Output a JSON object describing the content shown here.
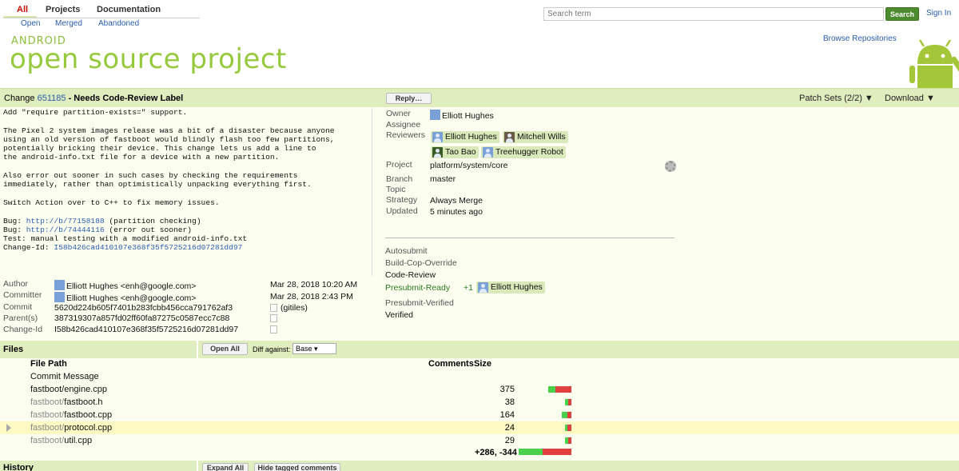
{
  "nav": {
    "tabs": [
      "All",
      "Projects",
      "Documentation"
    ],
    "subtabs": [
      "Open",
      "Merged",
      "Abandoned"
    ],
    "search_placeholder": "Search term",
    "search_label": "Search",
    "signin_label": "Sign In"
  },
  "banner": {
    "logo_small": "ANDROID",
    "logo_big": "open source project",
    "browse_label": "Browse Repositories"
  },
  "change": {
    "prefix": "Change",
    "number": "651185",
    "status": "- Needs Code-Review Label",
    "reply_label": "Reply…",
    "patch_sets": "Patch Sets (2/2) ▼",
    "download": "Download ▼"
  },
  "commit_message": "Add \"require partition-exists=\" support.\n\nThe Pixel 2 system images release was a bit of a disaster because anyone\nusing an old version of fastboot would blindly flash too few partitions,\npotentially bricking their device. This change lets us add a line to\nthe android-info.txt file for a device with a new partition.\n\nAlso error out sooner in such cases by checking the requirements\nimmediately, rather than optimistically unpacking everything first.\n\nSwitch Action over to C++ to fix memory issues.\n\nBug: ",
  "bugs": [
    {
      "prefix": "Bug: ",
      "link": "http://b/77158188",
      "note": " (partition checking)"
    },
    {
      "prefix": "Bug: ",
      "link": "http://b/74444116",
      "note": " (error out sooner)"
    }
  ],
  "test_line": "Test: manual testing with a modified android-info.txt",
  "change_id_label": "Change-Id: ",
  "change_id": "I58b426cad410107e368f35f5725216d07281dd97",
  "info": {
    "owner_label": "Owner",
    "owner": "Elliott Hughes",
    "assignee_label": "Assignee",
    "reviewers_label": "Reviewers",
    "reviewers": [
      "Elliott Hughes",
      "Mitchell Wills",
      "Tao Bao",
      "Treehugger Robot"
    ],
    "project_label": "Project",
    "project": "platform/system/core",
    "branch_label": "Branch",
    "branch": "master",
    "topic_label": "Topic",
    "strategy_label": "Strategy",
    "strategy": "Always Merge",
    "updated_label": "Updated",
    "updated": "5 minutes ago"
  },
  "labels": {
    "autosubmit": "Autosubmit",
    "build_cop": "Build-Cop-Override",
    "code_review": "Code-Review",
    "presubmit_ready": "Presubmit-Ready",
    "presubmit_vote": "+1",
    "presubmit_voter": "Elliott Hughes",
    "presubmit_verified": "Presubmit-Verified",
    "verified": "Verified"
  },
  "commit_info": {
    "author_label": "Author",
    "author": "Elliott Hughes <enh@google.com>",
    "author_date": "Mar 28, 2018 10:20 AM",
    "committer_label": "Committer",
    "committer": "Elliott Hughes <enh@google.com>",
    "committer_date": "Mar 28, 2018 2:43 PM",
    "commit_label": "Commit",
    "commit": "5620d224b605f7401b283fcbb456cca791762af3",
    "gitiles": "(gitiles)",
    "parent_label": "Parent(s)",
    "parent": "387319307a857fd02ff60fa87275c0587ecc7c88",
    "changeid_label": "Change-Id",
    "changeid": "I58b426cad410107e368f35f5725216d07281dd97"
  },
  "files": {
    "title": "Files",
    "open_all": "Open All",
    "diff_against_label": "Diff against:",
    "diff_against_value": "Base ▾",
    "col_path": "File Path",
    "col_comments": "Comments",
    "col_size": "Size",
    "commit_message_row": "Commit Message",
    "rows": [
      {
        "dir": "",
        "name": "fastboot/engine.cpp",
        "size": "375",
        "green": 0.3,
        "red": 0.7,
        "width": 0.75
      },
      {
        "dir": "fastboot/",
        "name": "fastboot.h",
        "size": "38",
        "green": 0.5,
        "red": 0.5,
        "width": 0.16
      },
      {
        "dir": "fastboot/",
        "name": "fastboot.cpp",
        "size": "164",
        "green": 0.55,
        "red": 0.45,
        "width": 0.32
      },
      {
        "dir": "fastboot/",
        "name": "protocol.cpp",
        "size": "24",
        "green": 0.4,
        "red": 0.6,
        "width": 0.12
      },
      {
        "dir": "fastboot/",
        "name": "util.cpp",
        "size": "29",
        "green": 0.5,
        "red": 0.5,
        "width": 0.12
      }
    ],
    "total": "+286, -344"
  },
  "history": {
    "title": "History",
    "expand_all": "Expand All",
    "hide_tagged": "Hide tagged comments"
  },
  "colors": {
    "accent_bar": "#e0edbe",
    "link": "#2a5db0",
    "android_green": "#97c93d"
  }
}
